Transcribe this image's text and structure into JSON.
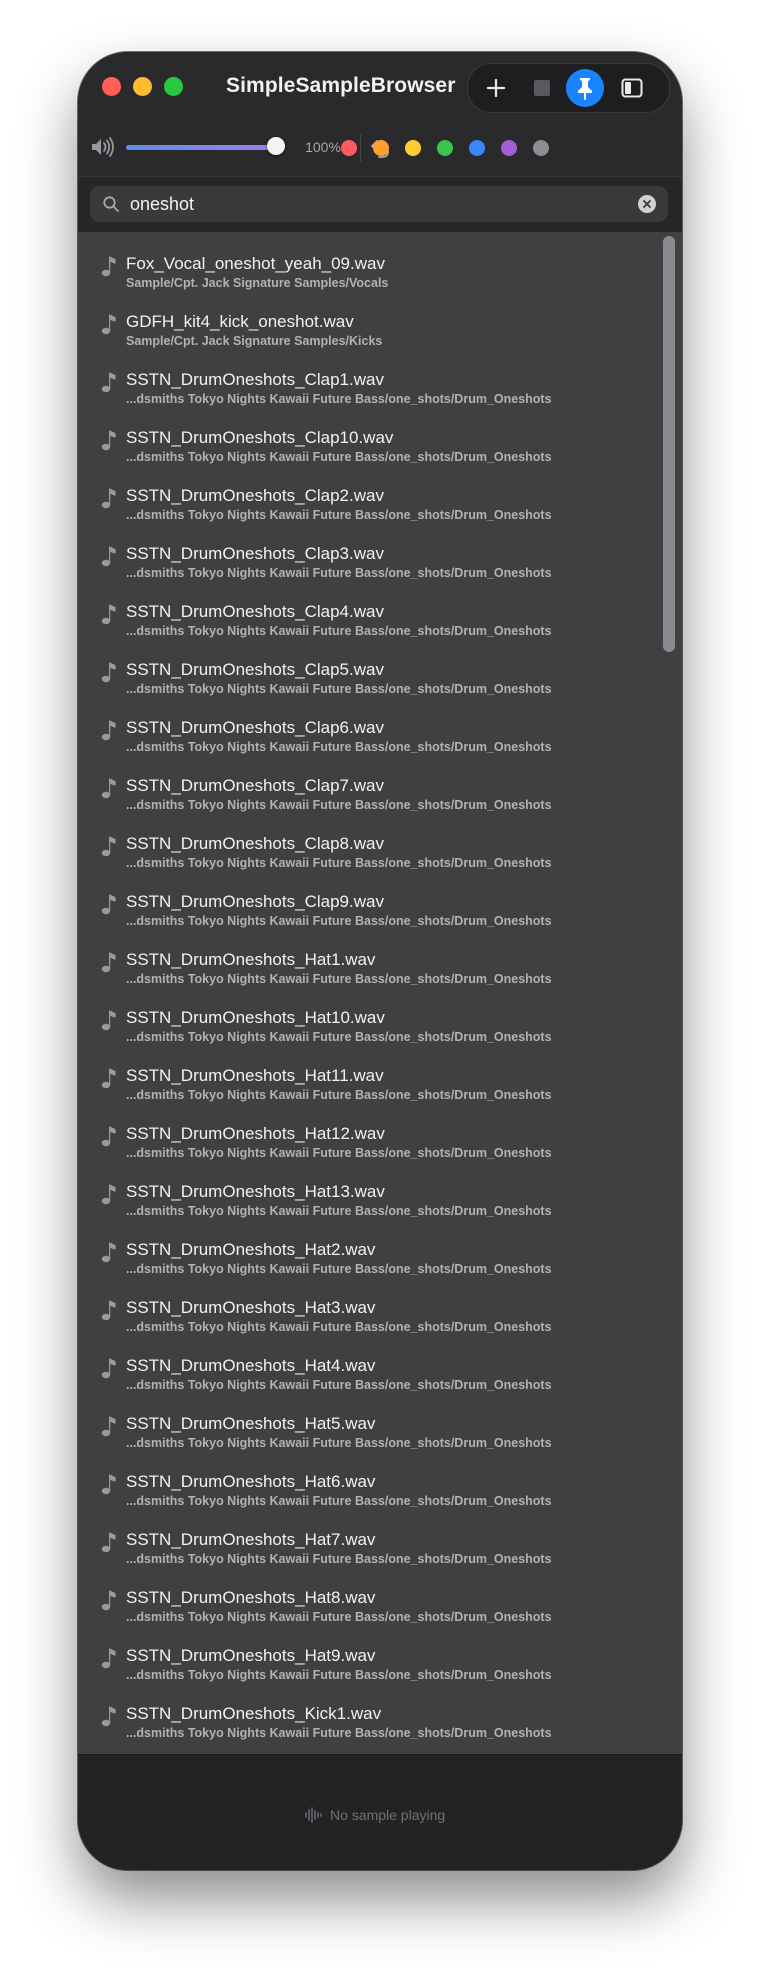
{
  "app": {
    "title": "SimpleSampleBrowser"
  },
  "toolbar": {
    "icons": [
      "plus-icon",
      "stop-icon",
      "pin-icon",
      "sidebar-icon"
    ],
    "pin_active_color": "#1a84ff"
  },
  "volume": {
    "level": 1.0,
    "label": "100%"
  },
  "color_filters": [
    "#ff5a5f",
    "#ff9f2e",
    "#ffcc33",
    "#3ec34f",
    "#3a86ff",
    "#9f5ed6",
    "#8e8e92"
  ],
  "search": {
    "value": "oneshot",
    "placeholder": ""
  },
  "results": [
    {
      "name": "Fox_Vocal_oneshot_yeah_09.wav",
      "path": "Sample/Cpt. Jack Signature Samples/Vocals"
    },
    {
      "name": "GDFH_kit4_kick_oneshot.wav",
      "path": "Sample/Cpt. Jack Signature Samples/Kicks"
    },
    {
      "name": "SSTN_DrumOneshots_Clap1.wav",
      "path": "...dsmiths Tokyo Nights Kawaii Future Bass/one_shots/Drum_Oneshots"
    },
    {
      "name": "SSTN_DrumOneshots_Clap10.wav",
      "path": "...dsmiths Tokyo Nights Kawaii Future Bass/one_shots/Drum_Oneshots"
    },
    {
      "name": "SSTN_DrumOneshots_Clap2.wav",
      "path": "...dsmiths Tokyo Nights Kawaii Future Bass/one_shots/Drum_Oneshots"
    },
    {
      "name": "SSTN_DrumOneshots_Clap3.wav",
      "path": "...dsmiths Tokyo Nights Kawaii Future Bass/one_shots/Drum_Oneshots"
    },
    {
      "name": "SSTN_DrumOneshots_Clap4.wav",
      "path": "...dsmiths Tokyo Nights Kawaii Future Bass/one_shots/Drum_Oneshots"
    },
    {
      "name": "SSTN_DrumOneshots_Clap5.wav",
      "path": "...dsmiths Tokyo Nights Kawaii Future Bass/one_shots/Drum_Oneshots"
    },
    {
      "name": "SSTN_DrumOneshots_Clap6.wav",
      "path": "...dsmiths Tokyo Nights Kawaii Future Bass/one_shots/Drum_Oneshots"
    },
    {
      "name": "SSTN_DrumOneshots_Clap7.wav",
      "path": "...dsmiths Tokyo Nights Kawaii Future Bass/one_shots/Drum_Oneshots"
    },
    {
      "name": "SSTN_DrumOneshots_Clap8.wav",
      "path": "...dsmiths Tokyo Nights Kawaii Future Bass/one_shots/Drum_Oneshots"
    },
    {
      "name": "SSTN_DrumOneshots_Clap9.wav",
      "path": "...dsmiths Tokyo Nights Kawaii Future Bass/one_shots/Drum_Oneshots"
    },
    {
      "name": "SSTN_DrumOneshots_Hat1.wav",
      "path": "...dsmiths Tokyo Nights Kawaii Future Bass/one_shots/Drum_Oneshots"
    },
    {
      "name": "SSTN_DrumOneshots_Hat10.wav",
      "path": "...dsmiths Tokyo Nights Kawaii Future Bass/one_shots/Drum_Oneshots"
    },
    {
      "name": "SSTN_DrumOneshots_Hat11.wav",
      "path": "...dsmiths Tokyo Nights Kawaii Future Bass/one_shots/Drum_Oneshots"
    },
    {
      "name": "SSTN_DrumOneshots_Hat12.wav",
      "path": "...dsmiths Tokyo Nights Kawaii Future Bass/one_shots/Drum_Oneshots"
    },
    {
      "name": "SSTN_DrumOneshots_Hat13.wav",
      "path": "...dsmiths Tokyo Nights Kawaii Future Bass/one_shots/Drum_Oneshots"
    },
    {
      "name": "SSTN_DrumOneshots_Hat2.wav",
      "path": "...dsmiths Tokyo Nights Kawaii Future Bass/one_shots/Drum_Oneshots"
    },
    {
      "name": "SSTN_DrumOneshots_Hat3.wav",
      "path": "...dsmiths Tokyo Nights Kawaii Future Bass/one_shots/Drum_Oneshots"
    },
    {
      "name": "SSTN_DrumOneshots_Hat4.wav",
      "path": "...dsmiths Tokyo Nights Kawaii Future Bass/one_shots/Drum_Oneshots"
    },
    {
      "name": "SSTN_DrumOneshots_Hat5.wav",
      "path": "...dsmiths Tokyo Nights Kawaii Future Bass/one_shots/Drum_Oneshots"
    },
    {
      "name": "SSTN_DrumOneshots_Hat6.wav",
      "path": "...dsmiths Tokyo Nights Kawaii Future Bass/one_shots/Drum_Oneshots"
    },
    {
      "name": "SSTN_DrumOneshots_Hat7.wav",
      "path": "...dsmiths Tokyo Nights Kawaii Future Bass/one_shots/Drum_Oneshots"
    },
    {
      "name": "SSTN_DrumOneshots_Hat8.wav",
      "path": "...dsmiths Tokyo Nights Kawaii Future Bass/one_shots/Drum_Oneshots"
    },
    {
      "name": "SSTN_DrumOneshots_Hat9.wav",
      "path": "...dsmiths Tokyo Nights Kawaii Future Bass/one_shots/Drum_Oneshots"
    },
    {
      "name": "SSTN_DrumOneshots_Kick1.wav",
      "path": "...dsmiths Tokyo Nights Kawaii Future Bass/one_shots/Drum_Oneshots"
    }
  ],
  "player": {
    "status": "No sample playing",
    "icon": "waveform-icon"
  }
}
